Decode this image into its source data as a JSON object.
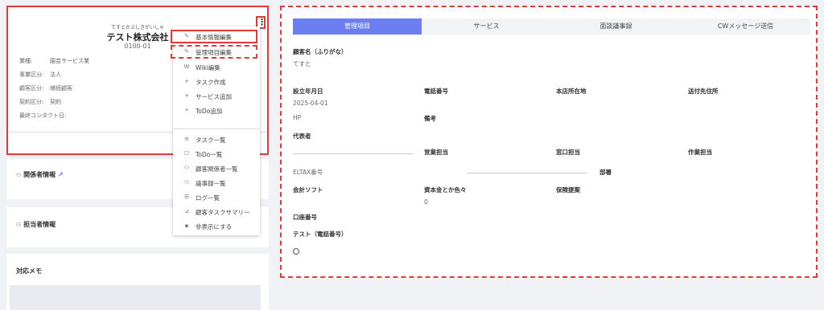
{
  "customer": {
    "furigana": "てすとかぶしきがいしゃ",
    "name": "テスト株式会社",
    "code": "0100-01",
    "menu_icon": "⋮",
    "info": [
      {
        "label": "業種:",
        "value": "園芸サービス業"
      },
      {
        "label": "事業区分:",
        "value": "法人"
      },
      {
        "label": "顧客区分:",
        "value": "継続顧客"
      },
      {
        "label": "契約区分:",
        "value": "契約"
      },
      {
        "label": "最終コンタクト日:",
        "value": ""
      }
    ]
  },
  "sections": {
    "related_info": "関係者情報",
    "assignee_info": "担当者情報",
    "memo": "対応メモ"
  },
  "menu": {
    "items": [
      {
        "icon": "edit-icon",
        "glyph": "✎",
        "label": "基本情報編集"
      },
      {
        "icon": "edit-icon",
        "glyph": "✎",
        "label": "管理項目編集"
      },
      {
        "icon": "wiki-icon",
        "glyph": "W",
        "label": "Wiki編集"
      },
      {
        "icon": "plus-icon",
        "glyph": "+",
        "label": "タスク作成"
      },
      {
        "icon": "plus-icon",
        "glyph": "+",
        "label": "サービス追加"
      },
      {
        "icon": "plus-icon",
        "glyph": "+",
        "label": "ToDo追加"
      },
      {
        "icon": "list-icon",
        "glyph": "≡",
        "label": "タスク一覧"
      },
      {
        "icon": "todo-icon",
        "glyph": "☐",
        "label": "ToDo一覧"
      },
      {
        "icon": "people-icon",
        "glyph": "⚇",
        "label": "顧客関係者一覧"
      },
      {
        "icon": "people-icon",
        "glyph": "⚇",
        "label": "議事録一覧"
      },
      {
        "icon": "log-icon",
        "glyph": "☰",
        "label": "ログ一覧"
      },
      {
        "icon": "chart-icon",
        "glyph": "⊿",
        "label": "顧客タスクサマリー"
      },
      {
        "icon": "trash-icon",
        "glyph": "▪",
        "label": "非表示にする"
      }
    ]
  },
  "tabs": [
    {
      "label": "管理項目",
      "active": true
    },
    {
      "label": "サービス",
      "active": false
    },
    {
      "label": "面談議事録",
      "active": false
    },
    {
      "label": "CWメッセージ送信",
      "active": false
    }
  ],
  "fields": {
    "furigana_label": "顧客名（ふりがな）",
    "furigana_value": "てすと",
    "founded_label": "設立年月日",
    "founded_value": "2025-04-01",
    "phone_label": "電話番号",
    "hq_label": "本店所在地",
    "ship_label": "送付先住所",
    "hp_label": "HP",
    "notes_label": "備考",
    "rep_label": "代表者",
    "sales_label": "営業担当",
    "window_label": "窓口担当",
    "work_label": "作業担当",
    "eltax_label": "ELTAX番号",
    "dept_label": "部署",
    "acct_label": "会計ソフト",
    "capital_label": "資本金とか色々",
    "capital_value": "0",
    "insurance_label": "保険提案",
    "account_label": "口座番号",
    "test_label": "テスト（電話番号）"
  }
}
